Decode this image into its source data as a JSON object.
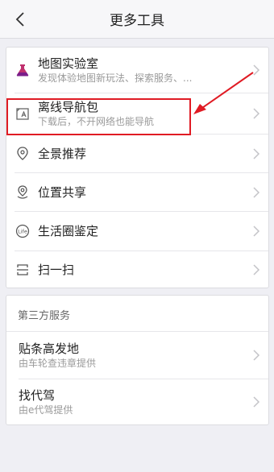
{
  "header": {
    "title": "更多工具"
  },
  "card1": {
    "items": [
      {
        "label": "地图实验室",
        "sub": "发现体验地图新玩法、探索服务、...",
        "icon": "lab-flask-icon"
      },
      {
        "label": "离线导航包",
        "sub": "下载后，不开网络也能导航",
        "icon": "offline-map-icon"
      },
      {
        "label": "全景推荐",
        "icon": "location-pin-icon"
      },
      {
        "label": "位置共享",
        "icon": "location-share-icon"
      },
      {
        "label": "生活圈鉴定",
        "icon": "life-badge-icon",
        "icon_text": "Life"
      },
      {
        "label": "扫一扫",
        "icon": "scan-icon"
      }
    ]
  },
  "card2": {
    "section_label": "第三方服务",
    "items": [
      {
        "label": "贴条高发地",
        "sub": "由车轮查违章提供"
      },
      {
        "label": "找代驾",
        "sub": "由e代驾提供"
      }
    ]
  },
  "colors": {
    "highlight": "#e01b24",
    "flask": "#c0306e",
    "background": "#efeff4"
  }
}
